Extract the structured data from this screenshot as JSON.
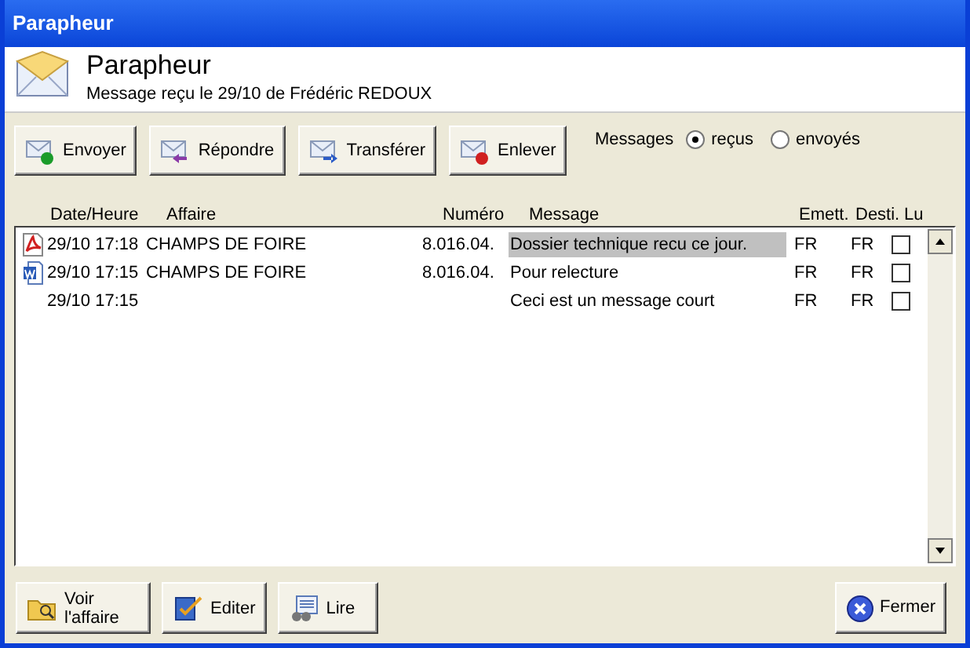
{
  "window": {
    "title": "Parapheur"
  },
  "header": {
    "title": "Parapheur",
    "subtitle": "Message reçu le 29/10 de Frédéric REDOUX"
  },
  "toolbar": [
    {
      "label": "Envoyer",
      "kind": "send"
    },
    {
      "label": "Répondre",
      "kind": "reply"
    },
    {
      "label": "Transférer",
      "kind": "forward"
    },
    {
      "label": "Enlever",
      "kind": "remove"
    }
  ],
  "filter": {
    "label": "Messages",
    "options": [
      {
        "label": "reçus",
        "selected": true
      },
      {
        "label": "envoyés",
        "selected": false
      }
    ]
  },
  "table": {
    "columns": [
      "Date/Heure",
      "Affaire",
      "Numéro",
      "Message",
      "Emett.",
      "Desti.",
      "Lu"
    ],
    "rows": [
      {
        "kind": "pdf",
        "date": "29/10 17:18",
        "affaire": "CHAMPS DE FOIRE",
        "numero": "8.016.04.",
        "message": "Dossier technique recu ce jour.",
        "emett": "FR",
        "desti": "FR",
        "lu": false,
        "selected": true
      },
      {
        "kind": "word",
        "date": "29/10 17:15",
        "affaire": "CHAMPS DE FOIRE",
        "numero": "8.016.04.",
        "message": "Pour relecture",
        "emett": "FR",
        "desti": "FR",
        "lu": false,
        "selected": false
      },
      {
        "kind": "none",
        "date": "29/10 17:15",
        "message": "Ceci est un message court",
        "emett": "FR",
        "desti": "FR",
        "lu": false,
        "selected": false
      }
    ]
  },
  "footer": {
    "left": [
      {
        "label": "Voir l'affaire",
        "kind": "folder"
      },
      {
        "label": "Editer",
        "kind": "edit"
      },
      {
        "label": "Lire",
        "kind": "read"
      }
    ],
    "right": [
      {
        "label": "Fermer",
        "kind": "close"
      }
    ]
  }
}
